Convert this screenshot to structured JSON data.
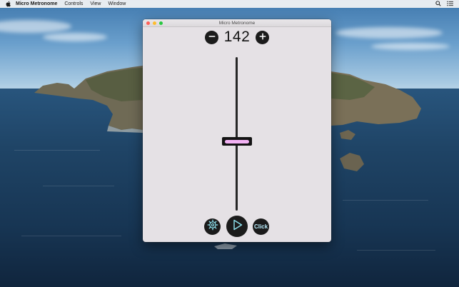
{
  "menubar": {
    "app_name": "Micro Metronome",
    "items": [
      "Controls",
      "View",
      "Window"
    ],
    "icons": [
      "apple-icon",
      "search-icon",
      "list-icon"
    ]
  },
  "window": {
    "title": "Micro Metronome",
    "traffic_lights": {
      "close": "#fe5f57",
      "minimize": "#febc2e",
      "zoom": "#28c840"
    }
  },
  "metronome": {
    "bpm": "142",
    "tempo_slider_fraction": 0.55,
    "decrement_icon": "minus-icon",
    "increment_icon": "plus-icon",
    "click_label": "Click",
    "thumb_accent": "#f3b2f4",
    "click_accent": "#bcefff",
    "icon_accent": "#8fe3f0"
  }
}
